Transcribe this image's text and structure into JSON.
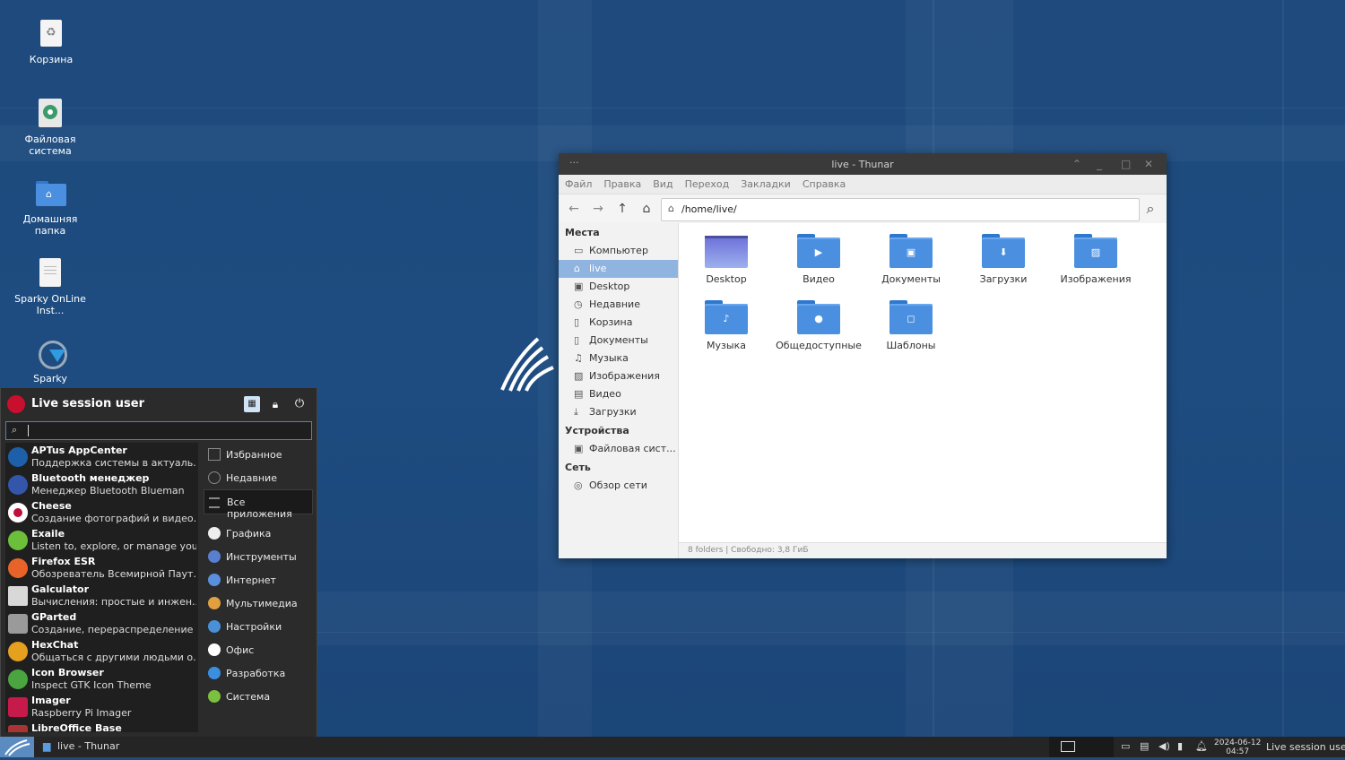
{
  "desktop": {
    "icons": [
      {
        "label": "Корзина",
        "icon": "trash-icon"
      },
      {
        "label": "Файловая система",
        "icon": "drive-icon"
      },
      {
        "label": "Домашняя папка",
        "icon": "home-folder-icon"
      },
      {
        "label": "Sparky OnLine Inst...",
        "icon": "document-icon"
      },
      {
        "label": "Sparky",
        "icon": "sparky-icon"
      }
    ]
  },
  "thunar": {
    "title": "live - Thunar",
    "menu": [
      "Файл",
      "Правка",
      "Вид",
      "Переход",
      "Закладки",
      "Справка"
    ],
    "path": "/home/live/",
    "sidebar": {
      "places_header": "Места",
      "places": [
        {
          "label": "Компьютер",
          "icon": "computer-icon"
        },
        {
          "label": "live",
          "icon": "home-icon",
          "selected": true
        },
        {
          "label": "Desktop",
          "icon": "desktop-icon"
        },
        {
          "label": "Недавние",
          "icon": "clock-icon"
        },
        {
          "label": "Корзина",
          "icon": "trash-icon"
        },
        {
          "label": "Документы",
          "icon": "document-icon"
        },
        {
          "label": "Музыка",
          "icon": "music-icon"
        },
        {
          "label": "Изображения",
          "icon": "image-icon"
        },
        {
          "label": "Видео",
          "icon": "video-icon"
        },
        {
          "label": "Загрузки",
          "icon": "download-icon"
        }
      ],
      "devices_header": "Устройства",
      "devices": [
        {
          "label": "Файловая сист...",
          "icon": "drive-icon"
        }
      ],
      "network_header": "Сеть",
      "network": [
        {
          "label": "Обзор сети",
          "icon": "network-icon"
        }
      ]
    },
    "folders": [
      {
        "label": "Desktop",
        "emblem": "desktop"
      },
      {
        "label": "Видео",
        "emblem": "▶"
      },
      {
        "label": "Документы",
        "emblem": "▣"
      },
      {
        "label": "Загрузки",
        "emblem": "⬇"
      },
      {
        "label": "Изображения",
        "emblem": "▨"
      },
      {
        "label": "Музыка",
        "emblem": "♪"
      },
      {
        "label": "Общедоступные",
        "emblem": "●"
      },
      {
        "label": "Шаблоны",
        "emblem": "◻"
      }
    ],
    "status": "8 folders  |  Свободно: 3,8 ГиБ"
  },
  "whisker": {
    "user": "Live session user",
    "apps": [
      {
        "name": "APTus AppCenter",
        "desc": "Поддержка системы в актуаль...",
        "color": "#1d5fa8"
      },
      {
        "name": "Bluetooth менеджер",
        "desc": "Менеджер Bluetooth Blueman",
        "color": "#3355aa"
      },
      {
        "name": "Cheese",
        "desc": "Создание фотографий и видео...",
        "color": "#e8e8e8"
      },
      {
        "name": "Exaile",
        "desc": "Listen to, explore, or manage you...",
        "color": "#6cbf3a"
      },
      {
        "name": "Firefox ESR",
        "desc": "Обозреватель Всемирной Паут...",
        "color": "#e8632a"
      },
      {
        "name": "Galculator",
        "desc": "Вычисления: простые и инжен...",
        "color": "#d8d8d8"
      },
      {
        "name": "GParted",
        "desc": "Создание, перераспределение ...",
        "color": "#9a9a9a"
      },
      {
        "name": "HexChat",
        "desc": "Общаться с другими людьми о...",
        "color": "#e6a020"
      },
      {
        "name": "Icon Browser",
        "desc": "Inspect GTK Icon Theme",
        "color": "#4aa540"
      },
      {
        "name": "Imager",
        "desc": "Raspberry Pi Imager",
        "color": "#c51a4a"
      },
      {
        "name": "LibreOffice Base",
        "desc": "",
        "color": "#a33"
      }
    ],
    "categories": [
      {
        "label": "Избранное",
        "color": "#666"
      },
      {
        "label": "Недавние",
        "color": "#666"
      },
      {
        "label": "Все приложения",
        "color": "#666",
        "selected": true
      },
      {
        "label": "Графика",
        "color": "#eee"
      },
      {
        "label": "Инструменты",
        "color": "#5a7fd0"
      },
      {
        "label": "Интернет",
        "color": "#5a8fe0"
      },
      {
        "label": "Мультимедиа",
        "color": "#e0a040"
      },
      {
        "label": "Настройки",
        "color": "#4a90d8"
      },
      {
        "label": "Офис",
        "color": "#fff"
      },
      {
        "label": "Разработка",
        "color": "#3a8fe0"
      },
      {
        "label": "Система",
        "color": "#7cc040"
      }
    ]
  },
  "taskbar": {
    "task": "live - Thunar",
    "date": "2024-06-12",
    "time": "04:57",
    "user": "Live session user"
  }
}
